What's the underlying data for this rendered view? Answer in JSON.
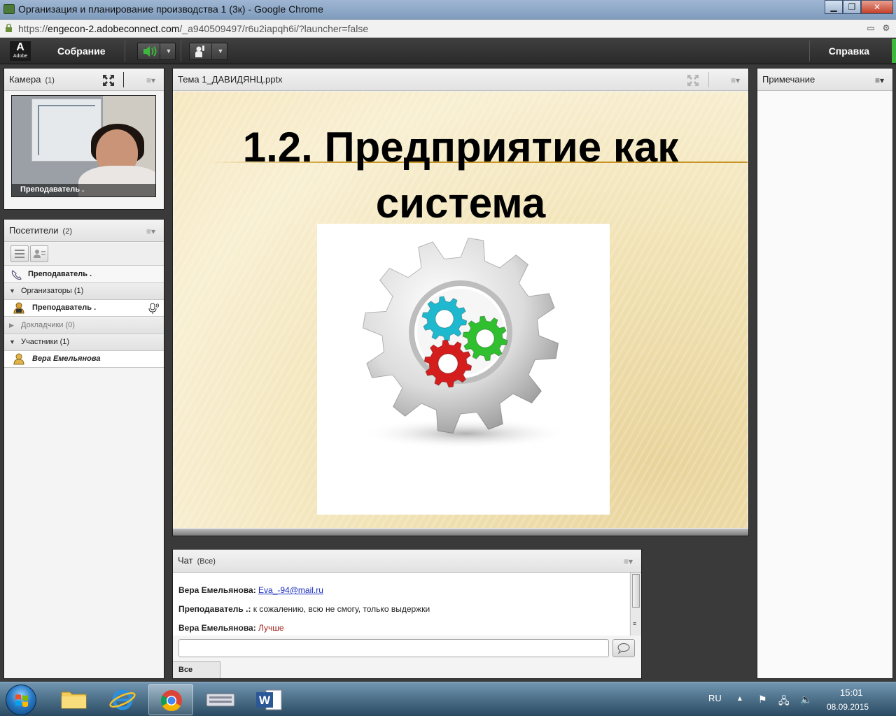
{
  "browser": {
    "window_title": "Организация и планирование производства 1 (3к) - Google Chrome",
    "url_scheme": "https://",
    "url_host": "engecon-2.adobeconnect.com",
    "url_path": "/_a940509497/r6u2iapqh6i/?launcher=false",
    "minimize_label": "▁",
    "maximize_label": "❐",
    "close_label": "✕"
  },
  "menubar": {
    "logo_letter": "A",
    "logo_text": "Adobe",
    "meeting_label": "Собрание",
    "help_label": "Справка"
  },
  "camera_pod": {
    "title": "Камера",
    "count": "(1)",
    "video_label": "Преподаватель ."
  },
  "attendees_pod": {
    "title": "Посетители",
    "count": "(2)",
    "phone_row": "Преподаватель .",
    "hosts_group": "Организаторы (1)",
    "host_user": "Преподаватель .",
    "presenters_group": "Докладчики (0)",
    "participants_group": "Участники (1)",
    "participant_user": "Вера Емельянова"
  },
  "share_pod": {
    "title": "Тема 1_ДАВИДЯНЦ.pptx",
    "slide_title_line1": "1.2. Предприятие как",
    "slide_title_line2": "система"
  },
  "chat_pod": {
    "title": "Чат",
    "scope": "(Все)",
    "messages": [
      {
        "sender": "Вера Емельянова:",
        "text": "Eva_-94@mail.ru"
      },
      {
        "sender": "Преподаватель .:",
        "text": "к сожалению, всю не смогу, только выдержки"
      },
      {
        "sender": "Вера Емельянова:",
        "text": "Лучше"
      }
    ],
    "input_placeholder": "",
    "tab_all": "Все"
  },
  "notes_pod": {
    "title": "Примечание"
  },
  "taskbar": {
    "language": "RU",
    "time": "15:01",
    "date": "08.09.2015"
  },
  "colors": {
    "connect_bg": "#3a3a3a",
    "speaker_green": "#3db83d",
    "link_blue": "#1a2ebd",
    "chat_red": "#a2231c",
    "gear_cyan": "#1fb9cf",
    "gear_green": "#2fbf2f",
    "gear_red": "#d41d1d"
  }
}
